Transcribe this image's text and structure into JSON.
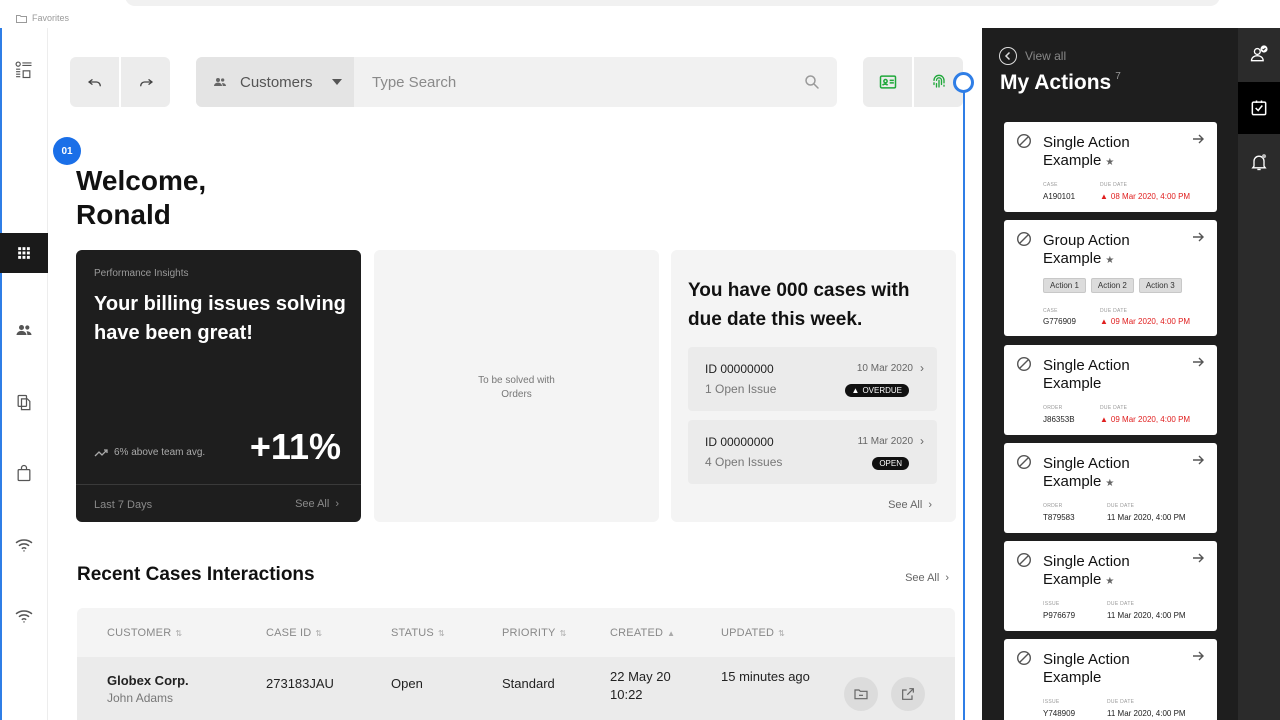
{
  "browser": {
    "favorites_label": "Favorites"
  },
  "toolbar": {
    "search_scope": "Customers",
    "search_placeholder": "Type Search"
  },
  "step": {
    "number": "01"
  },
  "welcome": {
    "line1": "Welcome,",
    "line2": "Ronald"
  },
  "insight_card": {
    "eyebrow": "Performance Insights",
    "headline": "Your billing issues solving have been great!",
    "trend_text": "6% above team avg.",
    "big_value": "+11%",
    "period": "Last 7 Days",
    "see_all": "See All"
  },
  "placeholder_card": {
    "text": "To be solved with Orders"
  },
  "cases_card": {
    "headline": "You have 000 cases with due date this week.",
    "items": [
      {
        "id": "ID 00000000",
        "issues": "1 Open Issue",
        "date": "10 Mar 2020",
        "status": "OVERDUE"
      },
      {
        "id": "ID 00000000",
        "issues": "4 Open Issues",
        "date": "11 Mar 2020",
        "status": "OPEN"
      }
    ],
    "see_all": "See All"
  },
  "recent": {
    "title": "Recent Cases Interactions",
    "see_all": "See All",
    "columns": [
      "CUSTOMER",
      "CASE ID",
      "STATUS",
      "PRIORITY",
      "CREATED",
      "UPDATED"
    ],
    "rows": [
      {
        "customer": "Globex Corp.",
        "contact": "John Adams",
        "case_id": "273183JAU",
        "status": "Open",
        "priority": "Standard",
        "created_date": "22 May 20",
        "created_time": "10:22",
        "updated": "15 minutes ago"
      }
    ]
  },
  "actions": {
    "view_all": "View all",
    "title": "My Actions",
    "count": "7",
    "items": [
      {
        "title": "Single Action Example",
        "lbl1": "CASE",
        "val1": "A190101",
        "lbl2": "DUE DATE",
        "val2": "08 Mar 2020, 4:00 PM",
        "overdue": true,
        "tags": []
      },
      {
        "title": "Group Action Example",
        "lbl1": "CASE",
        "val1": "G776909",
        "lbl2": "DUE DATE",
        "val2": "09 Mar 2020, 4:00 PM",
        "overdue": true,
        "tags": [
          "Action 1",
          "Action 2",
          "Action 3"
        ]
      },
      {
        "title": "Single Action Example",
        "lbl1": "ORDER",
        "val1": "J86353B",
        "lbl2": "DUE DATE",
        "val2": "09 Mar 2020, 4:00 PM",
        "overdue": true,
        "tags": []
      },
      {
        "title": "Single Action Example",
        "lbl1": "ORDER",
        "val1": "T879583",
        "lbl2": "DUE DATE",
        "val2": "11 Mar 2020, 4:00 PM",
        "overdue": false,
        "tags": []
      },
      {
        "title": "Single Action Example",
        "lbl1": "ISSUE",
        "val1": "P976679",
        "lbl2": "DUE DATE",
        "val2": "11 Mar 2020, 4:00 PM",
        "overdue": false,
        "tags": []
      },
      {
        "title": "Single Action Example",
        "lbl1": "ISSUE",
        "val1": "Y748909",
        "lbl2": "DUE DATE",
        "val2": "11 Mar 2020, 4:00 PM",
        "overdue": false,
        "tags": []
      }
    ]
  },
  "colors": {
    "accent_blue": "#2f7ee6",
    "badge_blue": "#1a6fe8",
    "overdue_red": "#e01e1e",
    "dark_panel": "#1e1e1e",
    "tool_green": "#1fa83a"
  },
  "icons": {
    "left_nav": [
      "layout-icon",
      "apps-grid-icon",
      "people-icon",
      "documents-icon",
      "shopping-bag-icon",
      "wifi-icon",
      "wifi-icon"
    ],
    "toolbar": [
      "undo-icon",
      "redo-icon",
      "people-icon",
      "search-icon",
      "id-card-icon",
      "fingerprint-icon"
    ],
    "right_rail": [
      "person-check-icon",
      "checkbox-icon",
      "bell-icon"
    ]
  }
}
